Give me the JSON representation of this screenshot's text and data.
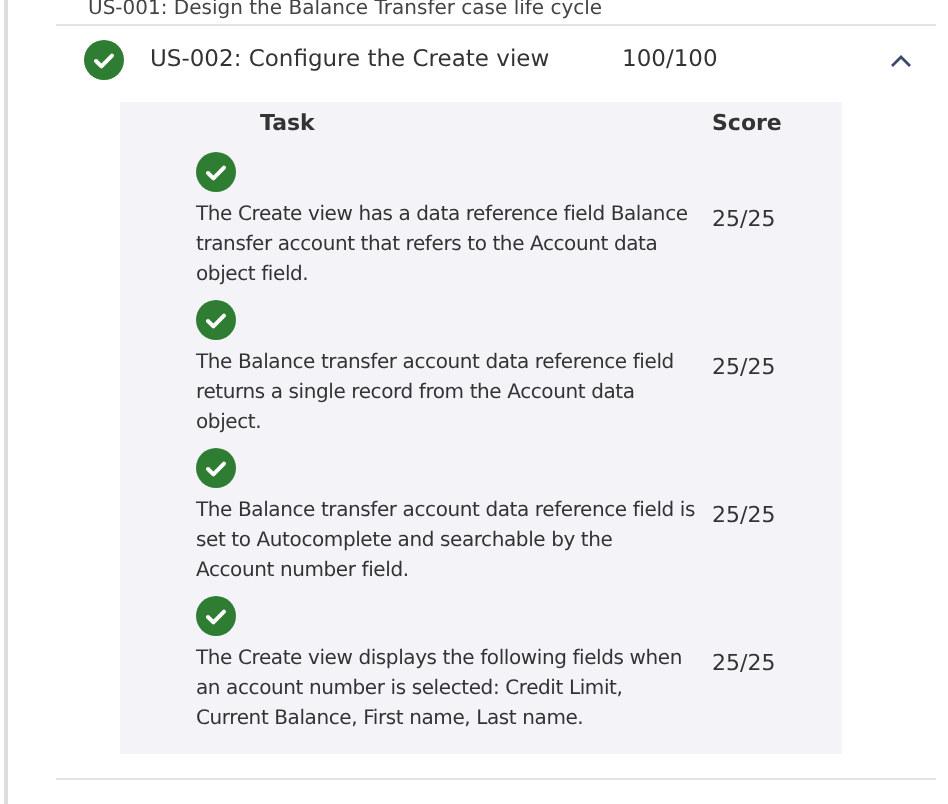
{
  "previous_story": {
    "title": "US-001: Design the Balance Transfer case life cycle"
  },
  "story": {
    "title": "US-002: Configure the Create view",
    "score": "100/100",
    "passed": true,
    "expanded": true,
    "columns": [
      "Task",
      "Score"
    ],
    "tasks": [
      {
        "text": "The Create view has a data reference field Balance transfer account that refers to the Account data object field.",
        "score": "25/25",
        "passed": true
      },
      {
        "text": "The Balance transfer account data reference field returns a single record from the Account data object.",
        "score": "25/25",
        "passed": true
      },
      {
        "text": "The Balance transfer account data reference field is set to Autocomplete and searchable by the Account number field.",
        "score": "25/25",
        "passed": true
      },
      {
        "text": "The Create view displays the following fields when an account number is selected: Credit Limit, Current Balance, First name, Last name.",
        "score": "25/25",
        "passed": true
      }
    ]
  }
}
